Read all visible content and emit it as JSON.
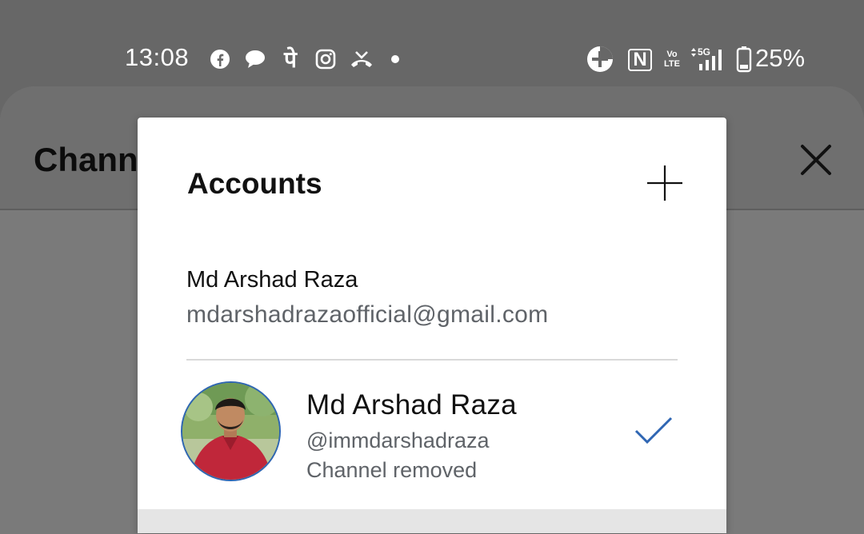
{
  "status_bar": {
    "time": "13:08",
    "notification_icons": [
      "facebook-icon",
      "chat-bubble-icon",
      "phonepe-icon",
      "instagram-icon",
      "missed-call-icon",
      "dot-icon"
    ],
    "nfc_label": "N",
    "volte_label_top": "Vo",
    "volte_label_bottom": "LTE",
    "network_label": "5G",
    "battery_percent": "25%"
  },
  "background_sheet": {
    "title": "Channe"
  },
  "dialog": {
    "title": "Accounts",
    "account": {
      "name": "Md Arshad Raza",
      "email": "mdarshadrazaofficial@gmail.com"
    },
    "channel": {
      "name": "Md Arshad Raza",
      "handle": "@immdarshadraza",
      "status": "Channel removed",
      "selected": true
    }
  },
  "colors": {
    "scrim": "#676767",
    "dialog_bg": "#ffffff",
    "accent_check": "#2f66b3",
    "secondary_text": "#5f6368"
  }
}
